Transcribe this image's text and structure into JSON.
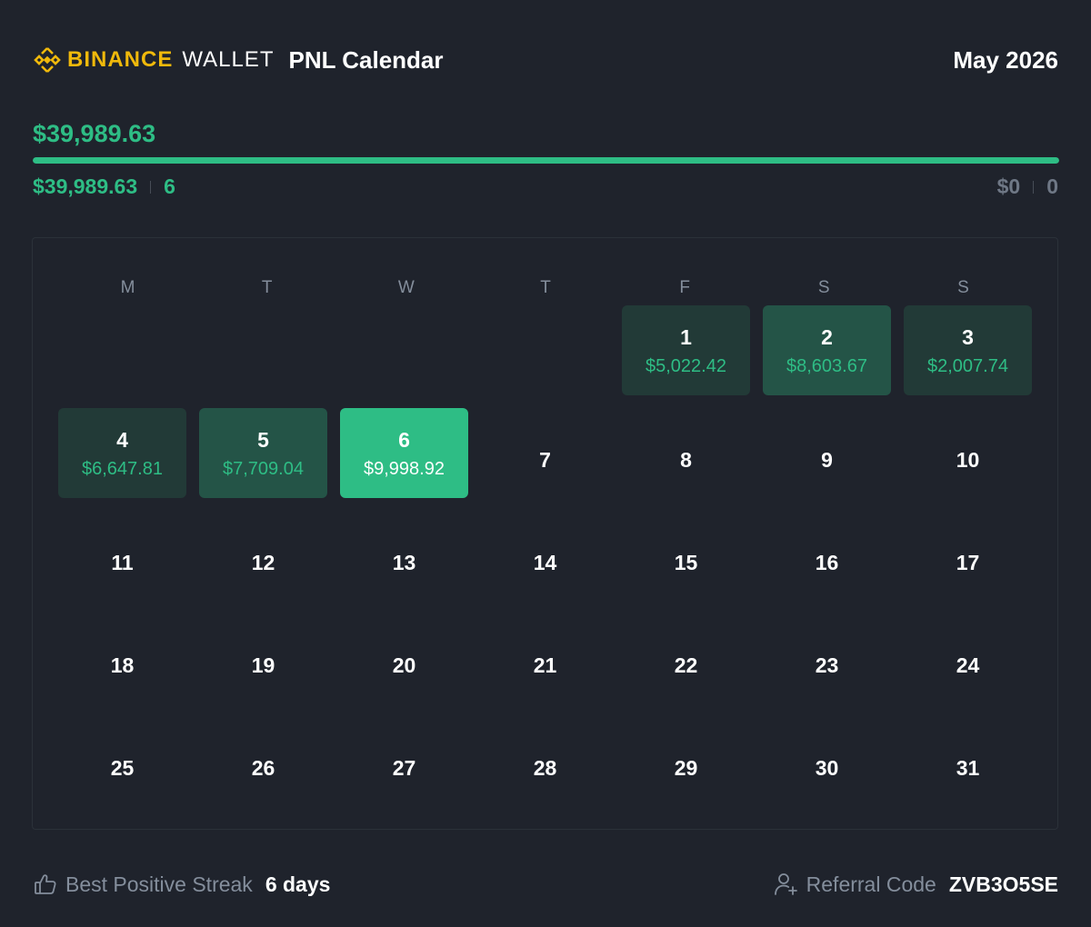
{
  "header": {
    "brand_name": "BINANCE",
    "brand_sub": "WALLET",
    "title": "PNL Calendar",
    "month": "May 2026"
  },
  "summary": {
    "total_pnl": "$39,989.63",
    "positive_fraction": 1.0,
    "positive_amount": "$39,989.63",
    "positive_days": "6",
    "negative_amount": "$0",
    "negative_days": "0"
  },
  "calendar": {
    "weekdays": [
      "M",
      "T",
      "W",
      "T",
      "F",
      "S",
      "S"
    ],
    "leading_blank_days": 4,
    "days": [
      {
        "day": "1",
        "pnl": "$5,022.42",
        "level": "low"
      },
      {
        "day": "2",
        "pnl": "$8,603.67",
        "level": "mid"
      },
      {
        "day": "3",
        "pnl": "$2,007.74",
        "level": "low"
      },
      {
        "day": "4",
        "pnl": "$6,647.81",
        "level": "low"
      },
      {
        "day": "5",
        "pnl": "$7,709.04",
        "level": "mid"
      },
      {
        "day": "6",
        "pnl": "$9,998.92",
        "level": "high"
      },
      {
        "day": "7"
      },
      {
        "day": "8"
      },
      {
        "day": "9"
      },
      {
        "day": "10"
      },
      {
        "day": "11"
      },
      {
        "day": "12"
      },
      {
        "day": "13"
      },
      {
        "day": "14"
      },
      {
        "day": "15"
      },
      {
        "day": "16"
      },
      {
        "day": "17"
      },
      {
        "day": "18"
      },
      {
        "day": "19"
      },
      {
        "day": "20"
      },
      {
        "day": "21"
      },
      {
        "day": "22"
      },
      {
        "day": "23"
      },
      {
        "day": "24"
      },
      {
        "day": "25"
      },
      {
        "day": "26"
      },
      {
        "day": "27"
      },
      {
        "day": "28"
      },
      {
        "day": "29"
      },
      {
        "day": "30"
      },
      {
        "day": "31"
      }
    ]
  },
  "footer": {
    "streak_label": "Best Positive Streak",
    "streak_value": "6 days",
    "referral_label": "Referral Code",
    "referral_code": "ZVB3O5SE"
  },
  "icons": {
    "logo": "binance-diamond-icon",
    "streak": "thumbs-up-icon",
    "referral": "add-user-icon"
  },
  "colors": {
    "background": "#1f232c",
    "brand": "#f0b90b",
    "positive": "#2ebd85",
    "muted": "#848e9c"
  }
}
